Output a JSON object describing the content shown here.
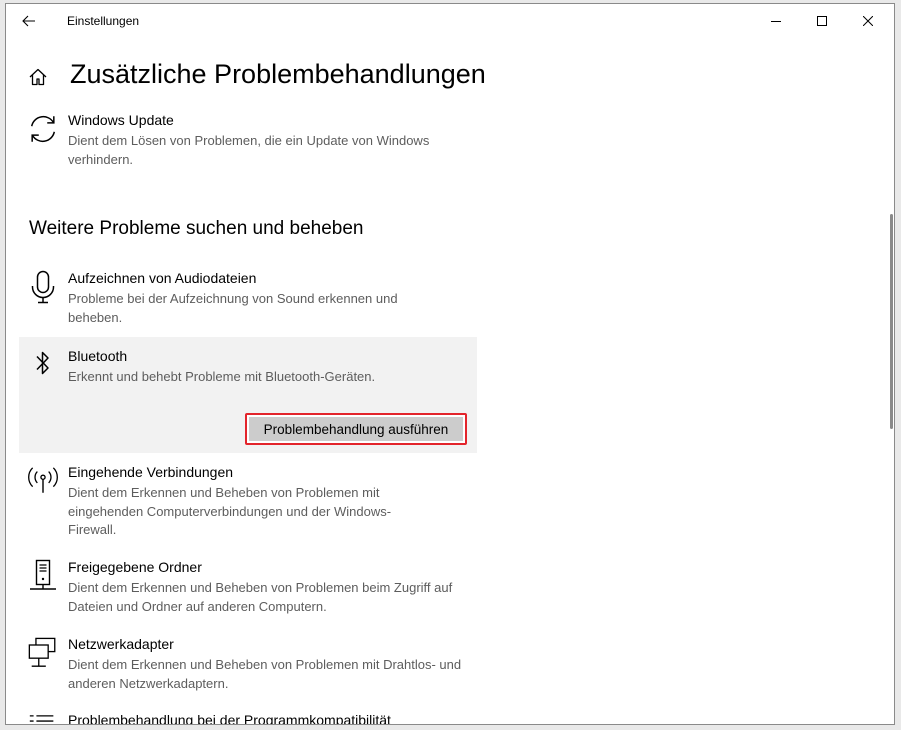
{
  "window": {
    "title": "Einstellungen"
  },
  "page": {
    "title": "Zusätzliche Problembehandlungen"
  },
  "top_item": {
    "icon": "refresh-icon",
    "name": "Windows Update",
    "description": "Dient dem Lösen von Problemen, die ein Update von Windows verhindern."
  },
  "section": {
    "title": "Weitere Probleme suchen und beheben"
  },
  "items": [
    {
      "icon": "microphone-icon",
      "name": "Aufzeichnen von Audiodateien",
      "description": "Probleme bei der Aufzeichnung von Sound erkennen und beheben."
    },
    {
      "icon": "bluetooth-icon",
      "name": "Bluetooth",
      "description": "Erkennt und behebt Probleme mit Bluetooth-Geräten.",
      "button_label": "Problembehandlung ausführen",
      "selected": true
    },
    {
      "icon": "antenna-icon",
      "name": "Eingehende Verbindungen",
      "description": "Dient dem Erkennen und Beheben von Problemen mit eingehenden Computerverbindungen und der Windows-Firewall."
    },
    {
      "icon": "server-icon",
      "name": "Freigegebene Ordner",
      "description": "Dient dem Erkennen und Beheben von Problemen beim Zugriff auf Dateien und Ordner auf anderen Computern."
    },
    {
      "icon": "network-adapter-icon",
      "name": "Netzwerkadapter",
      "description": "Dient dem Erkennen und Beheben von Problemen mit Drahtlos- und anderen Netzwerkadaptern."
    },
    {
      "icon": "list-icon",
      "name": "Problembehandlung bei der Programmkompatibilität",
      "description": ""
    }
  ],
  "colors": {
    "highlight_border": "#e3242b",
    "card_background": "#f2f2f2",
    "button_background": "#cccccc",
    "description_text": "#5d5d5d"
  }
}
